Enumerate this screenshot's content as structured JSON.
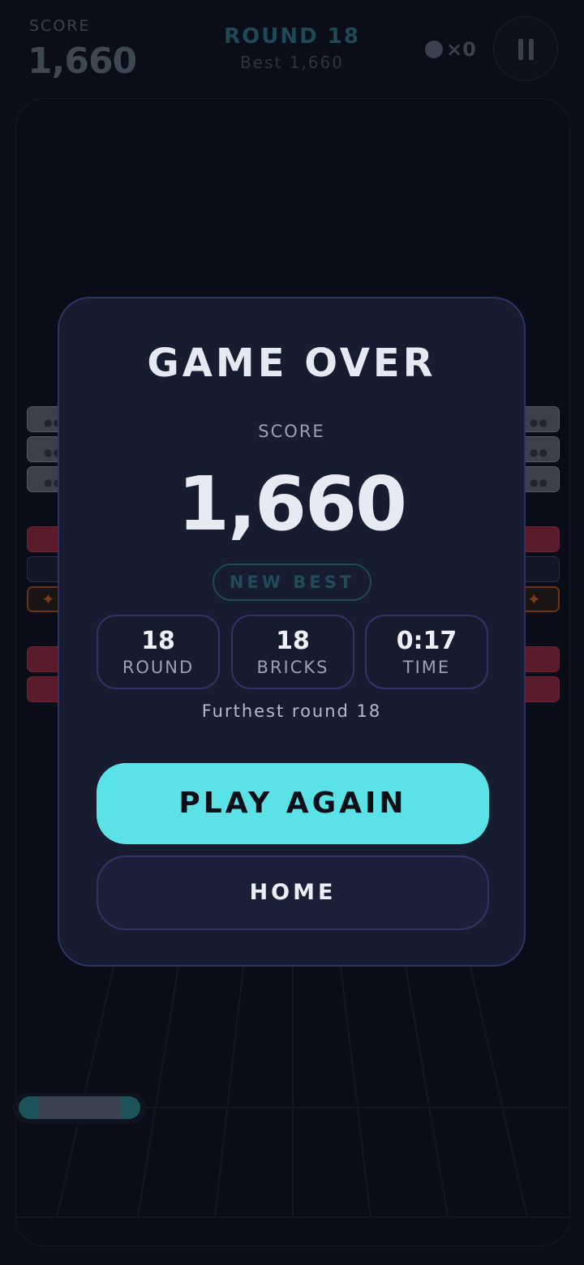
{
  "hud": {
    "score_label": "SCORE",
    "score_value": "1,660",
    "round_title": "ROUND 18",
    "best_line": "Best 1,660",
    "ball_count": "×0",
    "pause_icon": "pause-icon"
  },
  "playfield": {
    "brick_colors": {
      "grey": "#3c404b",
      "red": "#5a1b2a",
      "orange": "#6a3416"
    },
    "paddle_color": "#1d5459"
  },
  "game_over": {
    "title": "GAME OVER",
    "score_label": "SCORE",
    "score_value": "1,660",
    "badge": "NEW BEST",
    "stats": [
      {
        "value": "18",
        "label": "ROUND"
      },
      {
        "value": "18",
        "label": "BRICKS"
      },
      {
        "value": "0:17",
        "label": "TIME"
      }
    ],
    "furthest": "Furthest round 18",
    "play_again": "PLAY AGAIN",
    "home": "HOME"
  },
  "colors": {
    "accent": "#5ae2e6",
    "panel": "#181c30",
    "panel_border": "#2e3566",
    "background": "#0b0e18"
  }
}
